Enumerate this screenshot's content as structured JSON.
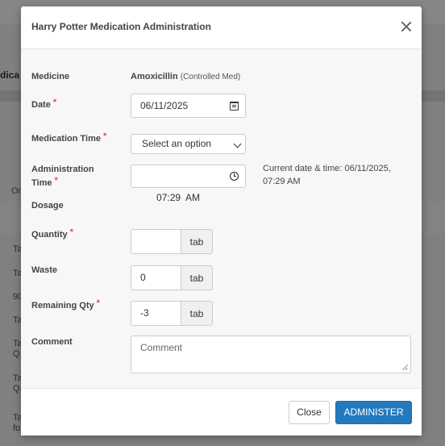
{
  "modal": {
    "title": "Harry Potter Medication Administration",
    "close_icon": "close-icon"
  },
  "form": {
    "medicine": {
      "label": "Medicine",
      "name": "Amoxicillin",
      "note": "(Controlled Med)"
    },
    "date": {
      "label": "Date",
      "value": "06/11/2025",
      "icon": "calendar-icon"
    },
    "medication_time": {
      "label": "Medication Time",
      "selected": "Select an option"
    },
    "administration_time": {
      "label_line1": "Administration",
      "label_line2": "Time",
      "value": "07:29  AM",
      "icon": "clock-icon"
    },
    "current_datetime": {
      "line1": "Current date & time: 06/11/2025,",
      "line2": "07:29 AM"
    },
    "dosage": {
      "label": "Dosage"
    },
    "quantity": {
      "label": "Quantity",
      "value": "",
      "unit": "tab"
    },
    "waste": {
      "label": "Waste",
      "value": "0",
      "unit": "tab"
    },
    "remaining_qty": {
      "label": "Remaining Qty",
      "value": "-3",
      "unit": "tab"
    },
    "comment": {
      "label": "Comment",
      "placeholder": "Comment"
    },
    "required_marker": "*"
  },
  "footer": {
    "close_label": "Close",
    "administer_label": "ADMINISTER"
  },
  "background": {
    "header_fragment": "dica",
    "column_fragment": "Or",
    "rows": [
      "Ta",
      "Ta",
      "90",
      "Ta",
      "Ta\nQ.",
      "Ta\nQ.",
      "Ta\nfo"
    ]
  },
  "colors": {
    "primary": "#2479bd",
    "required": "#d9534f"
  }
}
